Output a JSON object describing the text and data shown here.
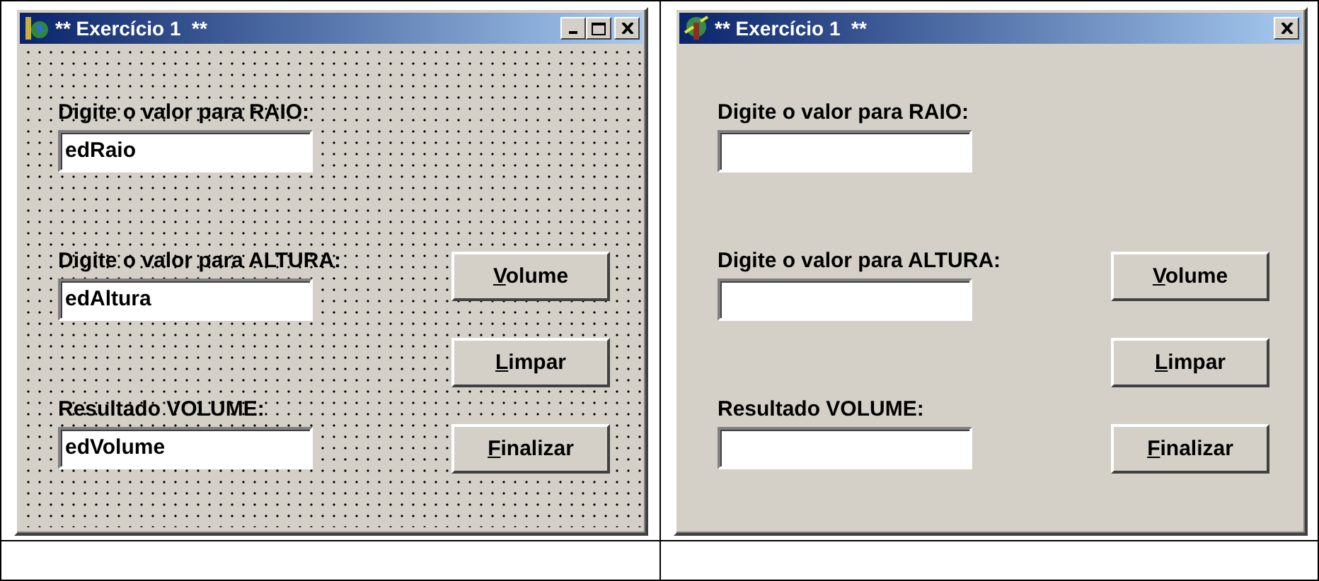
{
  "forms": [
    {
      "kind": "design",
      "title": "** Exercício 1  **",
      "caption_buttons": [
        {
          "kind": "minimize"
        },
        {
          "kind": "maximize"
        },
        {
          "kind": "close"
        }
      ],
      "fields": [
        {
          "label": "Digite o valor para RAIO:",
          "value": "edRaio"
        },
        {
          "label": "Digite o valor para ALTURA:",
          "value": "edAltura"
        },
        {
          "label": "Resultado VOLUME:",
          "value": "edVolume"
        }
      ],
      "buttons": [
        "Volume",
        "Limpar",
        "Finalizar"
      ]
    },
    {
      "kind": "runtime",
      "title": "** Exercício 1  **",
      "caption_buttons": [
        {
          "kind": "close"
        }
      ],
      "fields": [
        {
          "label": "Digite o valor para RAIO:"
        },
        {
          "label": "Digite o valor para ALTURA:"
        },
        {
          "label": "Resultado VOLUME:"
        }
      ],
      "buttons": [
        "Volume",
        "Limpar",
        "Finalizar"
      ]
    }
  ]
}
